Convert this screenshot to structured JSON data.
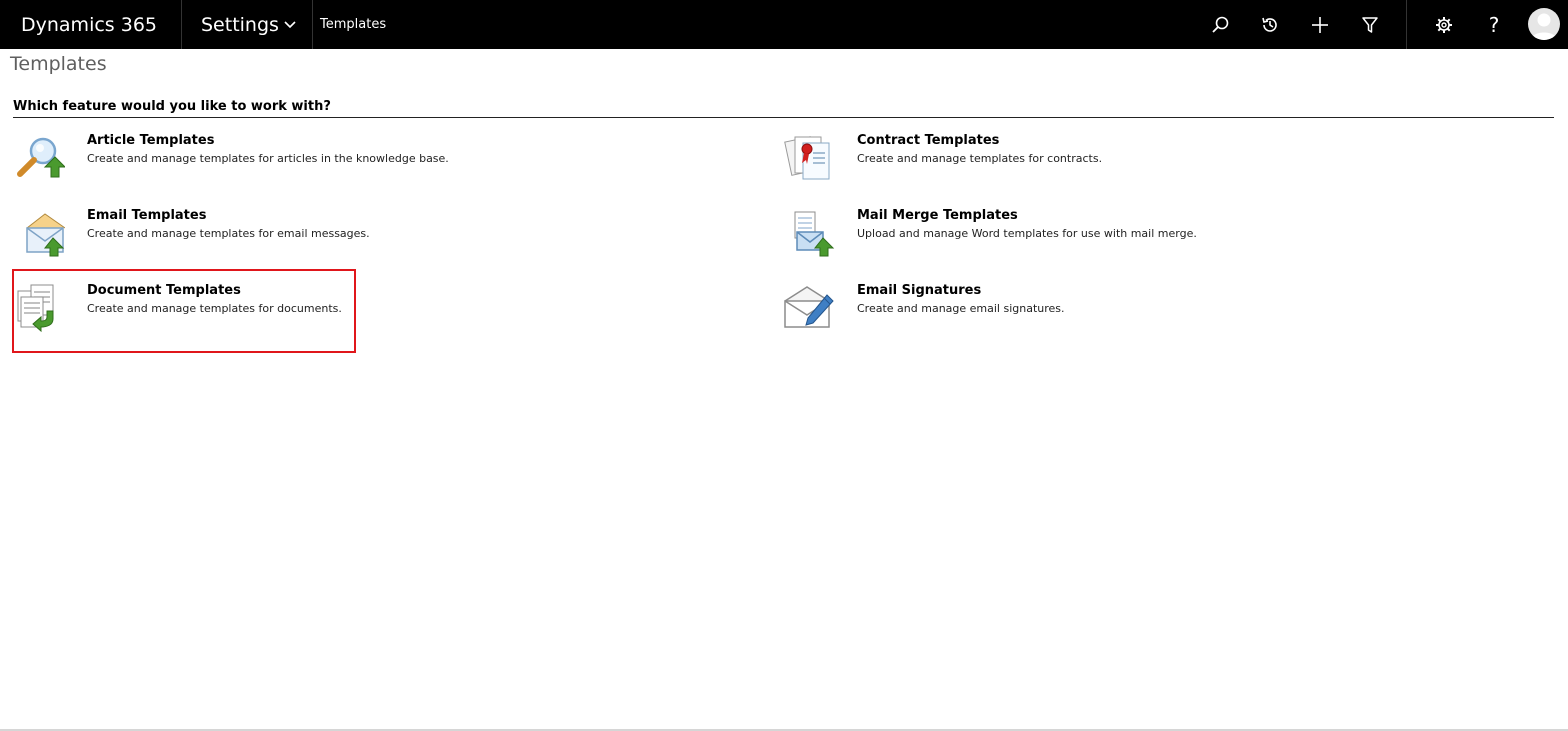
{
  "topbar": {
    "brand": "Dynamics 365",
    "area": "Settings",
    "breadcrumb": "Templates",
    "icons": [
      "search-icon",
      "recent-icon",
      "plus-icon",
      "filter-icon",
      "gear-icon",
      "help-icon",
      "avatar"
    ],
    "help_glyph": "?"
  },
  "page": {
    "title": "Templates",
    "section_heading": "Which feature would you like to work with?"
  },
  "features": [
    {
      "title": "Article Templates",
      "description": "Create and manage templates for articles in the knowledge base.",
      "icon": "article-template-icon"
    },
    {
      "title": "Contract Templates",
      "description": "Create and manage templates for contracts.",
      "icon": "contract-template-icon"
    },
    {
      "title": "Email Templates",
      "description": "Create and manage templates for email messages.",
      "icon": "email-template-icon"
    },
    {
      "title": "Mail Merge Templates",
      "description": "Upload and manage Word templates for use with mail merge.",
      "icon": "mail-merge-template-icon"
    },
    {
      "title": "Document Templates",
      "description": "Create and manage templates for documents.",
      "icon": "document-template-icon",
      "highlighted": true
    },
    {
      "title": "Email Signatures",
      "description": "Create and manage email signatures.",
      "icon": "email-signature-icon"
    }
  ],
  "colors": {
    "topbar_bg": "#000000",
    "highlight": "#e0161b",
    "arrow_green": "#4a9a2e"
  }
}
